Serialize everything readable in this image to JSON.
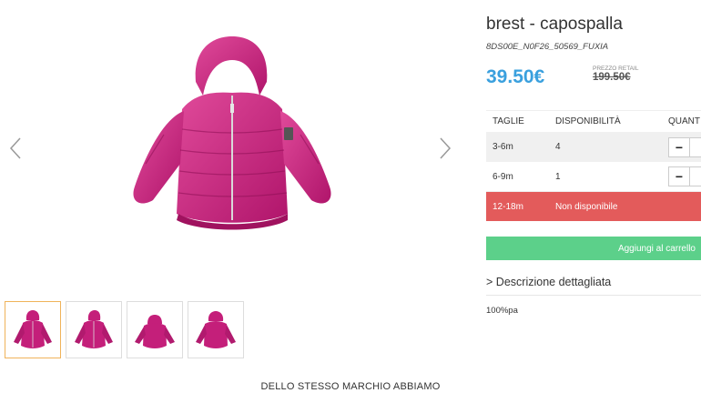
{
  "product": {
    "title": "brest - capospalla",
    "sku": "8DS00E_N0F26_50569_FUXIA",
    "price": "39.50€",
    "retail_label": "PREZZO RETAIL",
    "retail_price": "199.50€"
  },
  "sizes_table": {
    "headers": [
      "TAGLIE",
      "DISPONIBILITÀ",
      "QUANT"
    ],
    "rows": [
      {
        "size": "3-6m",
        "availability": "4",
        "qty_button": "−"
      },
      {
        "size": "6-9m",
        "availability": "1",
        "qty_button": "−"
      },
      {
        "size": "12-18m",
        "availability": "Non disponibile"
      }
    ]
  },
  "cart_button": "Aggiungi al carrello",
  "description": {
    "heading": "Descrizione dettagliata",
    "chevron": ">",
    "text": "100%pa"
  },
  "footer_title": "DELLO STESSO MARCHIO ABBIAMO",
  "colors": {
    "price": "#3aa0de",
    "unavailable": "#e35b5b",
    "cart": "#5cd08a",
    "jacket": "#c41f7a"
  },
  "icons": [
    "chevron-left-icon",
    "chevron-right-icon",
    "minus-icon"
  ]
}
